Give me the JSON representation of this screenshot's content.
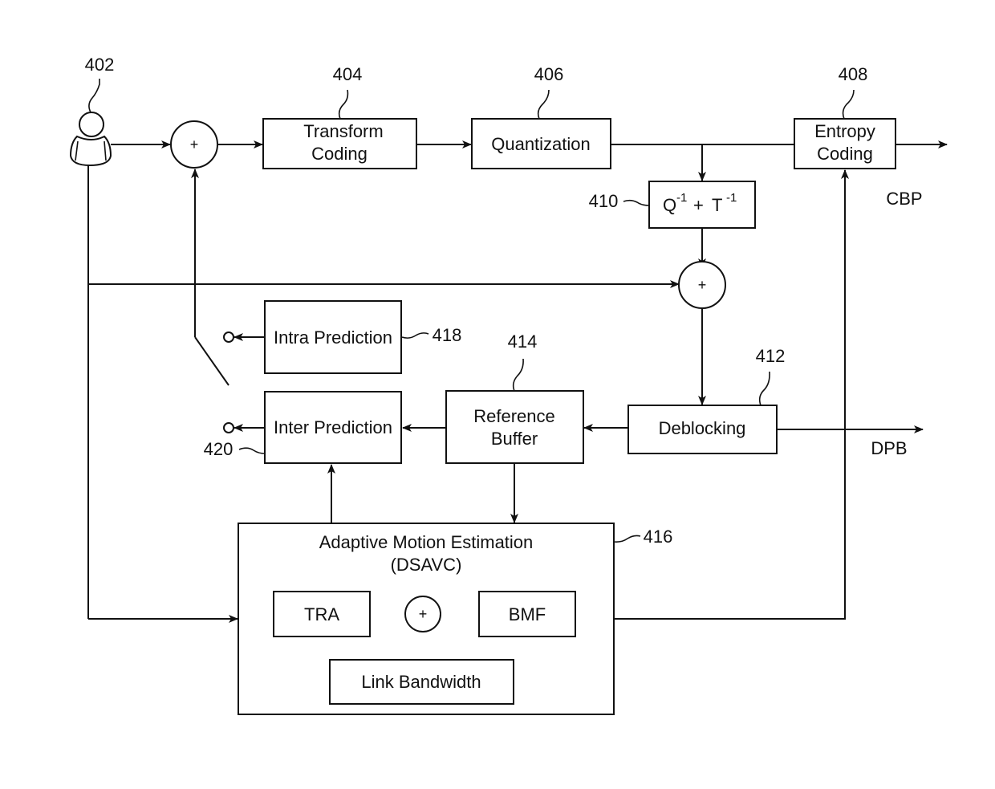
{
  "diagram": {
    "type": "block-diagram",
    "description": "Video encoder with adaptive motion estimation",
    "source": {
      "ref": "402",
      "icon": "user-icon"
    },
    "blocks": {
      "transform": {
        "ref": "404",
        "line1": "Transform",
        "line2": "Coding"
      },
      "quantization": {
        "ref": "406",
        "label": "Quantization"
      },
      "entropy": {
        "ref": "408",
        "line1": "Entropy",
        "line2": "Coding"
      },
      "inverse": {
        "ref": "410",
        "q": "Q",
        "q_exp": "-1",
        "plus": "+",
        "t": "T",
        "t_exp": "-1"
      },
      "deblocking": {
        "ref": "412",
        "label": "Deblocking"
      },
      "reference_buffer": {
        "ref": "414",
        "line1": "Reference",
        "line2": "Buffer"
      },
      "motion_estimation": {
        "ref": "416",
        "line1": "Adaptive Motion Estimation",
        "line2": "(DSAVC)"
      },
      "intra": {
        "ref": "418",
        "label": "Intra Prediction"
      },
      "inter": {
        "ref": "420",
        "label": "Inter Prediction"
      },
      "tra": {
        "label": "TRA"
      },
      "bmf": {
        "label": "BMF"
      },
      "link_bandwidth": {
        "label": "Link Bandwidth"
      }
    },
    "summing_symbol": "+",
    "outputs": {
      "cbp": "CBP",
      "dpb": "DPB"
    }
  }
}
